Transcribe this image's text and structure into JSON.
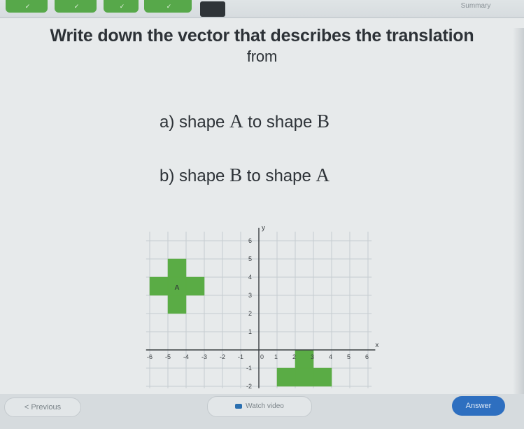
{
  "nav": {
    "tabs": [
      {
        "label": "",
        "state": "done"
      },
      {
        "label": "",
        "state": "done"
      },
      {
        "label": "",
        "state": "done"
      },
      {
        "label": "",
        "state": "done"
      },
      {
        "label": "",
        "state": "done"
      },
      {
        "label": "",
        "state": "current"
      },
      {
        "label": "",
        "state": "pending"
      },
      {
        "label": "",
        "state": "pending"
      },
      {
        "label": "",
        "state": "pending"
      },
      {
        "label": "",
        "state": "pending"
      },
      {
        "label": "",
        "state": "pending"
      }
    ],
    "summary_label": "Summary"
  },
  "question": {
    "line1": "Write down the vector that describes the translation",
    "line2": "from",
    "part_a": {
      "prefix": "a) shape ",
      "from": "A",
      "mid": " to shape ",
      "to": "B"
    },
    "part_b": {
      "prefix": "b) shape ",
      "from": "B",
      "mid": " to shape ",
      "to": "A"
    }
  },
  "graph": {
    "x_label": "x",
    "y_label": "y",
    "x_range": [
      -6,
      6
    ],
    "y_range": [
      -2,
      6
    ],
    "x_ticks": [
      -6,
      -5,
      -4,
      -3,
      -2,
      -1,
      0,
      1,
      2,
      3,
      4,
      5,
      6
    ],
    "y_ticks": [
      -2,
      -1,
      1,
      2,
      3,
      4,
      5,
      6
    ],
    "shape_color": "#5aac45",
    "shape_a_label": "A",
    "shape_a_cells": [
      [
        -5,
        2
      ],
      [
        -5,
        3
      ],
      [
        -5,
        4
      ],
      [
        -6,
        3
      ],
      [
        -4,
        3
      ]
    ],
    "shape_b_cells": [
      [
        1,
        -2
      ],
      [
        2,
        -2
      ],
      [
        3,
        -2
      ],
      [
        2,
        -1
      ]
    ]
  },
  "footer": {
    "previous_label": "< Previous",
    "watch_label": "Watch video",
    "answer_label": "Answer"
  }
}
